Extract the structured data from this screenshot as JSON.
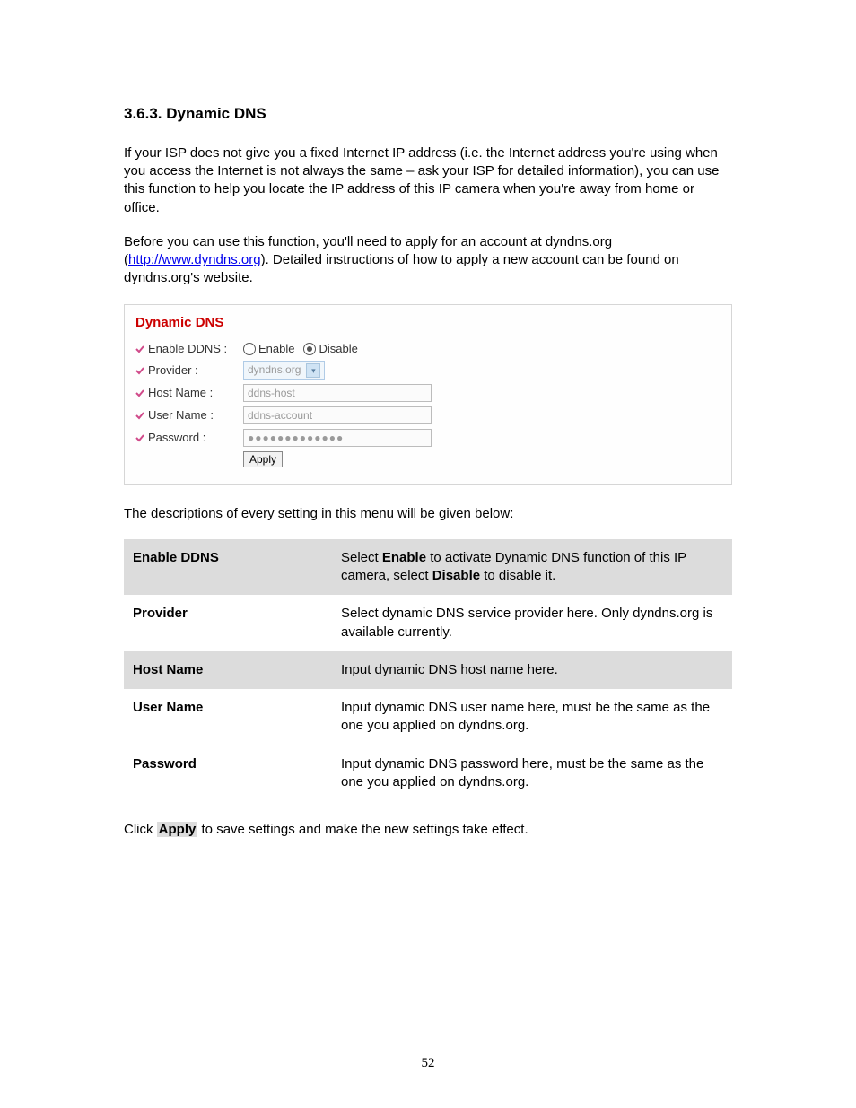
{
  "heading": "3.6.3.  Dynamic DNS",
  "intro_p1": "If your ISP does not give you a fixed Internet IP address (i.e. the Internet address you're using when you access the Internet is not always the same – ask your ISP for detailed information), you can use this function to help you locate the IP address of this IP camera when you're away from home or office.",
  "intro_p2_pre": "Before you can use this function, you'll need to apply for an account at dyndns.org (",
  "intro_link_text": "http://www.dyndns.org",
  "intro_p2_post": "). Detailed instructions of how to apply a new account can be found on dyndns.org's website.",
  "panel": {
    "title": "Dynamic DNS",
    "rows": {
      "enable_label": "Enable DDNS :",
      "enable_opt1": "Enable",
      "enable_opt2": "Disable",
      "provider_label": "Provider :",
      "provider_value": "dyndns.org",
      "host_label": "Host Name :",
      "host_value": "ddns-host",
      "user_label": "User Name :",
      "user_value": "ddns-account",
      "pass_label": "Password :",
      "pass_value": "●●●●●●●●●●●●●",
      "apply": "Apply"
    }
  },
  "desc_intro": "The descriptions of every setting in this menu will be given below:",
  "table": [
    {
      "shade": true,
      "name": "Enable DDNS",
      "desc_pre": "Select ",
      "b1": "Enable",
      "mid": " to activate Dynamic DNS function of this IP camera, select ",
      "b2": "Disable",
      "post": " to disable it."
    },
    {
      "shade": false,
      "name": "Provider",
      "desc": "Select dynamic DNS service provider here. Only dyndns.org is available currently."
    },
    {
      "shade": true,
      "name": "Host Name",
      "desc": "Input dynamic DNS host name here."
    },
    {
      "shade": false,
      "name": "User Name",
      "desc": "Input dynamic DNS user name here, must be the same as the one you applied on dyndns.org."
    },
    {
      "shade": false,
      "name": "Password",
      "desc": "Input dynamic DNS password here, must be the same as the one you applied on dyndns.org."
    }
  ],
  "closing_pre": "Click ",
  "closing_bold": "Apply",
  "closing_post": " to save settings and make the new settings take effect.",
  "page_number": "52"
}
